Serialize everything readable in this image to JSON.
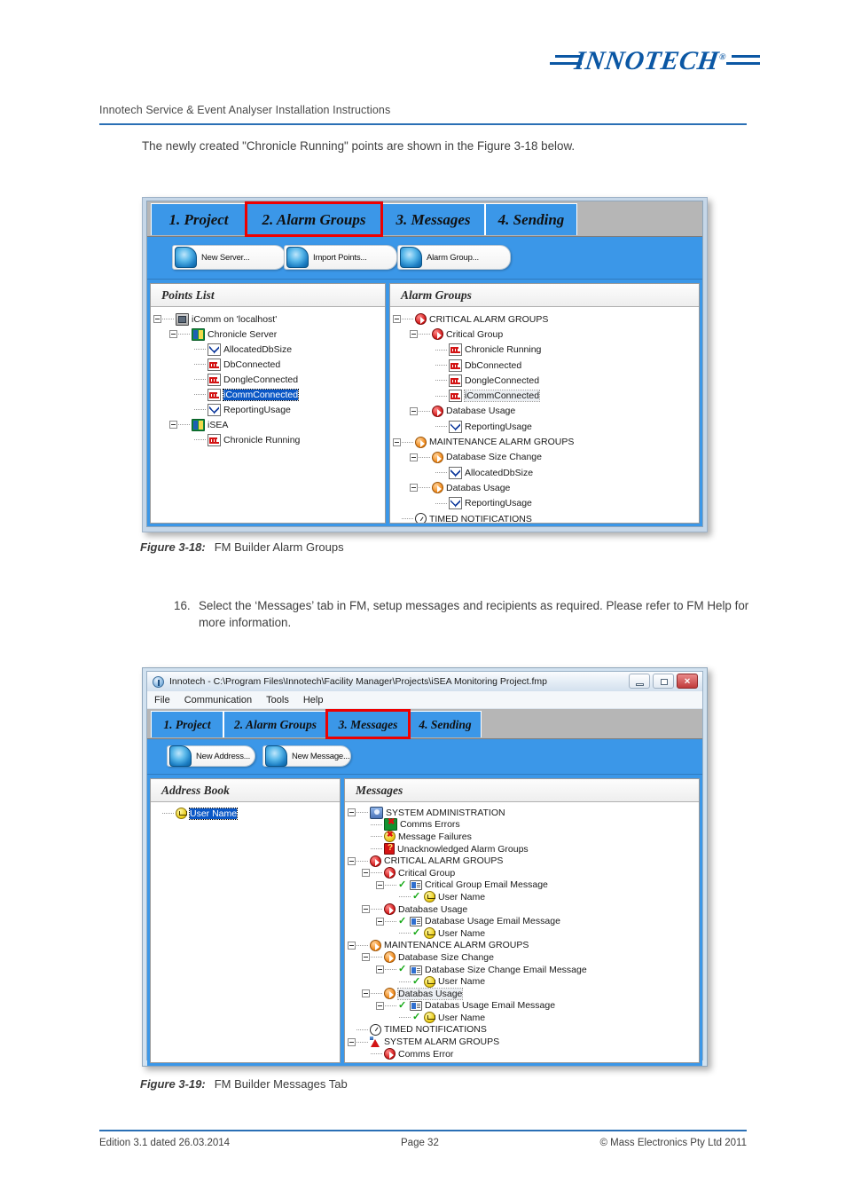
{
  "page": {
    "header_text": "Innotech Service & Event Analyser Installation Instructions",
    "logo": "INNOTECH",
    "logo_reg": "®",
    "para1": "The newly created \"Chronicle Running\" points are shown in the Figure 3-18 below.",
    "step": {
      "number": "16.",
      "text": "Select the ‘Messages’ tab in FM, setup messages and recipients as required. Please refer to FM Help for more information."
    },
    "figures": [
      {
        "label": "Figure 3-18:",
        "caption": "FM Builder Alarm Groups"
      },
      {
        "label": "Figure 3-19:",
        "caption": "FM Builder Messages Tab"
      }
    ],
    "footer": {
      "left": "Edition 3.1 dated 26.03.2014",
      "center": "Page 32",
      "right": "©  Mass Electronics Pty Ltd  2011"
    },
    "colors": {
      "brand_blue": "#0b57a4",
      "rule_blue": "#2a6fb5",
      "app_blue": "#3b97e8",
      "highlight_red": "#ee0000",
      "selection_blue": "#0a57c6"
    }
  },
  "fig1": {
    "tabs": [
      {
        "label": "1. Project",
        "selected": false
      },
      {
        "label": "2. Alarm Groups",
        "selected": true
      },
      {
        "label": "3. Messages",
        "selected": false
      },
      {
        "label": "4. Sending",
        "selected": false
      }
    ],
    "toolbar": [
      {
        "label": "New Server...",
        "icon": "orb-icon"
      },
      {
        "label": "Import Points...",
        "icon": "orb-icon"
      },
      {
        "label": "Alarm Group...",
        "icon": "orb-icon"
      }
    ],
    "left_pane": {
      "title": "Points List",
      "nodes": [
        {
          "depth": 0,
          "label": "iComm on 'localhost'",
          "icon": "computer-icon",
          "expander": true,
          "selected": false
        },
        {
          "depth": 1,
          "label": "Chronicle Server",
          "icon": "server-icon",
          "expander": true,
          "selected": false
        },
        {
          "depth": 2,
          "label": "AllocatedDbSize",
          "icon": "analog-point-icon",
          "expander": false,
          "selected": false
        },
        {
          "depth": 2,
          "label": "DbConnected",
          "icon": "digital-point-icon",
          "expander": false,
          "selected": false
        },
        {
          "depth": 2,
          "label": "DongleConnected",
          "icon": "digital-point-icon",
          "expander": false,
          "selected": false
        },
        {
          "depth": 2,
          "label": "iCommConnected",
          "icon": "digital-point-icon",
          "expander": false,
          "selected": true
        },
        {
          "depth": 2,
          "label": "ReportingUsage",
          "icon": "analog-point-icon",
          "expander": false,
          "selected": false
        },
        {
          "depth": 1,
          "label": "iSEA",
          "icon": "server-icon",
          "expander": true,
          "selected": false
        },
        {
          "depth": 2,
          "label": "Chronicle Running",
          "icon": "digital-point-icon",
          "expander": false,
          "selected": false
        }
      ]
    },
    "right_pane": {
      "title": "Alarm Groups",
      "nodes": [
        {
          "depth": 0,
          "label": "CRITICAL ALARM GROUPS",
          "icon": "alarm-group-red-icon",
          "expander": true,
          "ghost": false
        },
        {
          "depth": 1,
          "label": "Critical Group",
          "icon": "alarm-group-red-icon",
          "expander": true,
          "ghost": false
        },
        {
          "depth": 2,
          "label": "Chronicle Running",
          "icon": "digital-point-icon",
          "expander": false,
          "ghost": false
        },
        {
          "depth": 2,
          "label": "DbConnected",
          "icon": "digital-point-icon",
          "expander": false,
          "ghost": false
        },
        {
          "depth": 2,
          "label": "DongleConnected",
          "icon": "digital-point-icon",
          "expander": false,
          "ghost": false
        },
        {
          "depth": 2,
          "label": "iCommConnected",
          "icon": "digital-point-icon",
          "expander": false,
          "ghost": true
        },
        {
          "depth": 1,
          "label": "Database Usage",
          "icon": "alarm-group-red-icon",
          "expander": true,
          "ghost": false
        },
        {
          "depth": 2,
          "label": "ReportingUsage",
          "icon": "analog-point-icon",
          "expander": false,
          "ghost": false
        },
        {
          "depth": 0,
          "label": "MAINTENANCE ALARM GROUPS",
          "icon": "alarm-group-orange-icon",
          "expander": true,
          "ghost": false
        },
        {
          "depth": 1,
          "label": "Database Size Change",
          "icon": "alarm-group-orange-icon",
          "expander": true,
          "ghost": false
        },
        {
          "depth": 2,
          "label": "AllocatedDbSize",
          "icon": "analog-point-icon",
          "expander": false,
          "ghost": false
        },
        {
          "depth": 1,
          "label": "Databas Usage",
          "icon": "alarm-group-orange-icon",
          "expander": true,
          "ghost": false
        },
        {
          "depth": 2,
          "label": "ReportingUsage",
          "icon": "analog-point-icon",
          "expander": false,
          "ghost": false
        },
        {
          "depth": 0,
          "label": "TIMED NOTIFICATIONS",
          "icon": "clock-icon",
          "expander": false,
          "ghost": false
        }
      ]
    }
  },
  "fig2": {
    "window_title": "Innotech  - C:\\Program Files\\Innotech\\Facility Manager\\Projects\\iSEA Monitoring Project.fmp",
    "window_buttons": [
      {
        "name": "minimize",
        "glyph": "–"
      },
      {
        "name": "maximize",
        "glyph": "□"
      },
      {
        "name": "close",
        "glyph": "✕"
      }
    ],
    "menus": [
      "File",
      "Communication",
      "Tools",
      "Help"
    ],
    "tabs": [
      {
        "label": "1. Project",
        "selected": false
      },
      {
        "label": "2. Alarm Groups",
        "selected": false
      },
      {
        "label": "3. Messages",
        "selected": true
      },
      {
        "label": "4. Sending",
        "selected": false
      }
    ],
    "toolbar": [
      {
        "label": "New Address...",
        "icon": "orb-icon"
      },
      {
        "label": "New Message...",
        "icon": "orb-icon"
      }
    ],
    "left_pane": {
      "title": "Address Book",
      "nodes": [
        {
          "depth": 0,
          "label": "User Name",
          "icon": "user-icon",
          "expander": false,
          "selected": true
        }
      ]
    },
    "right_pane": {
      "title": "Messages",
      "nodes": [
        {
          "depth": 0,
          "label": "SYSTEM ADMINISTRATION",
          "icon": "admin-icon",
          "expander": true,
          "tick": false,
          "ghost": false
        },
        {
          "depth": 1,
          "label": "Comms Errors",
          "icon": "comms-error-icon",
          "expander": false,
          "tick": false,
          "ghost": false
        },
        {
          "depth": 1,
          "label": "Message Failures",
          "icon": "message-failure-icon",
          "expander": false,
          "tick": false,
          "ghost": false
        },
        {
          "depth": 1,
          "label": "Unacknowledged Alarm Groups",
          "icon": "unacknowledged-icon",
          "expander": false,
          "tick": false,
          "ghost": false
        },
        {
          "depth": 0,
          "label": "CRITICAL ALARM GROUPS",
          "icon": "alarm-group-red-icon",
          "expander": true,
          "tick": false,
          "ghost": false
        },
        {
          "depth": 1,
          "label": "Critical Group",
          "icon": "alarm-group-red-icon",
          "expander": true,
          "tick": false,
          "ghost": false
        },
        {
          "depth": 2,
          "label": "Critical Group Email Message",
          "icon": "email-message-icon",
          "expander": true,
          "tick": true,
          "ghost": false
        },
        {
          "depth": 3,
          "label": "User Name",
          "icon": "user-icon",
          "expander": false,
          "tick": true,
          "ghost": false
        },
        {
          "depth": 1,
          "label": "Database Usage",
          "icon": "alarm-group-red-icon",
          "expander": true,
          "tick": false,
          "ghost": false
        },
        {
          "depth": 2,
          "label": "Database Usage Email Message",
          "icon": "email-message-icon",
          "expander": true,
          "tick": true,
          "ghost": false
        },
        {
          "depth": 3,
          "label": "User Name",
          "icon": "user-icon",
          "expander": false,
          "tick": true,
          "ghost": false
        },
        {
          "depth": 0,
          "label": "MAINTENANCE ALARM GROUPS",
          "icon": "alarm-group-orange-icon",
          "expander": true,
          "tick": false,
          "ghost": false
        },
        {
          "depth": 1,
          "label": "Database Size Change",
          "icon": "alarm-group-orange-icon",
          "expander": true,
          "tick": false,
          "ghost": false
        },
        {
          "depth": 2,
          "label": "Database Size Change Email Message",
          "icon": "email-message-icon",
          "expander": true,
          "tick": true,
          "ghost": false
        },
        {
          "depth": 3,
          "label": "User Name",
          "icon": "user-icon",
          "expander": false,
          "tick": true,
          "ghost": false
        },
        {
          "depth": 1,
          "label": "Databas Usage",
          "icon": "alarm-group-orange-icon",
          "expander": true,
          "tick": false,
          "ghost": true
        },
        {
          "depth": 2,
          "label": "Databas Usage Email Message",
          "icon": "email-message-icon",
          "expander": true,
          "tick": true,
          "ghost": false
        },
        {
          "depth": 3,
          "label": "User Name",
          "icon": "user-icon",
          "expander": false,
          "tick": true,
          "ghost": false
        },
        {
          "depth": 0,
          "label": "TIMED NOTIFICATIONS",
          "icon": "clock-icon",
          "expander": false,
          "tick": false,
          "ghost": false
        },
        {
          "depth": 0,
          "label": "SYSTEM ALARM GROUPS",
          "icon": "system-alarm-icon",
          "expander": true,
          "tick": false,
          "ghost": false
        },
        {
          "depth": 1,
          "label": "Comms Error",
          "icon": "alarm-group-red-icon",
          "expander": false,
          "tick": false,
          "ghost": false
        }
      ]
    }
  }
}
